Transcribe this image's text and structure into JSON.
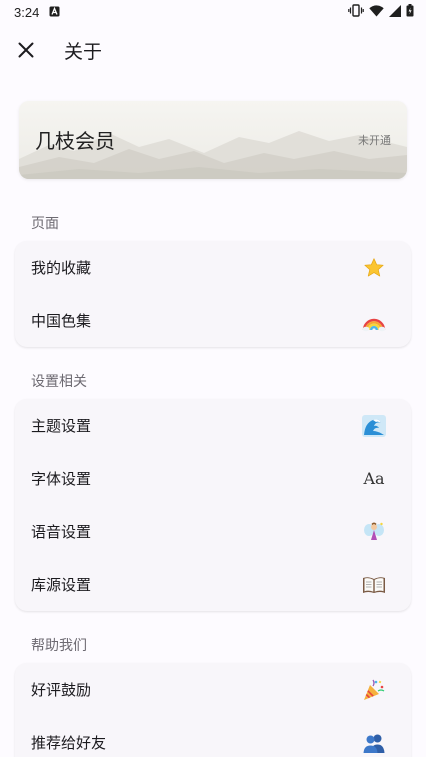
{
  "status_bar": {
    "time": "3:24",
    "icons": [
      "notification-a-icon",
      "vibrate-icon",
      "wifi-icon",
      "signal-icon",
      "battery-icon"
    ]
  },
  "app_bar": {
    "title": "关于",
    "close_icon": "close-icon"
  },
  "membership": {
    "title": "几枝会员",
    "status": "未开通"
  },
  "sections": [
    {
      "header": "页面",
      "items": [
        {
          "label": "我的收藏",
          "icon": "star-icon"
        },
        {
          "label": "中国色集",
          "icon": "rainbow-icon"
        }
      ]
    },
    {
      "header": "设置相关",
      "items": [
        {
          "label": "主题设置",
          "icon": "wave-icon"
        },
        {
          "label": "字体设置",
          "icon": "font-icon",
          "icon_text": "Aa"
        },
        {
          "label": "语音设置",
          "icon": "fairy-icon"
        },
        {
          "label": "库源设置",
          "icon": "book-icon"
        }
      ]
    },
    {
      "header": "帮助我们",
      "items": [
        {
          "label": "好评鼓励",
          "icon": "party-popper-icon"
        },
        {
          "label": "推荐给好友",
          "icon": "people-icon"
        }
      ]
    }
  ]
}
